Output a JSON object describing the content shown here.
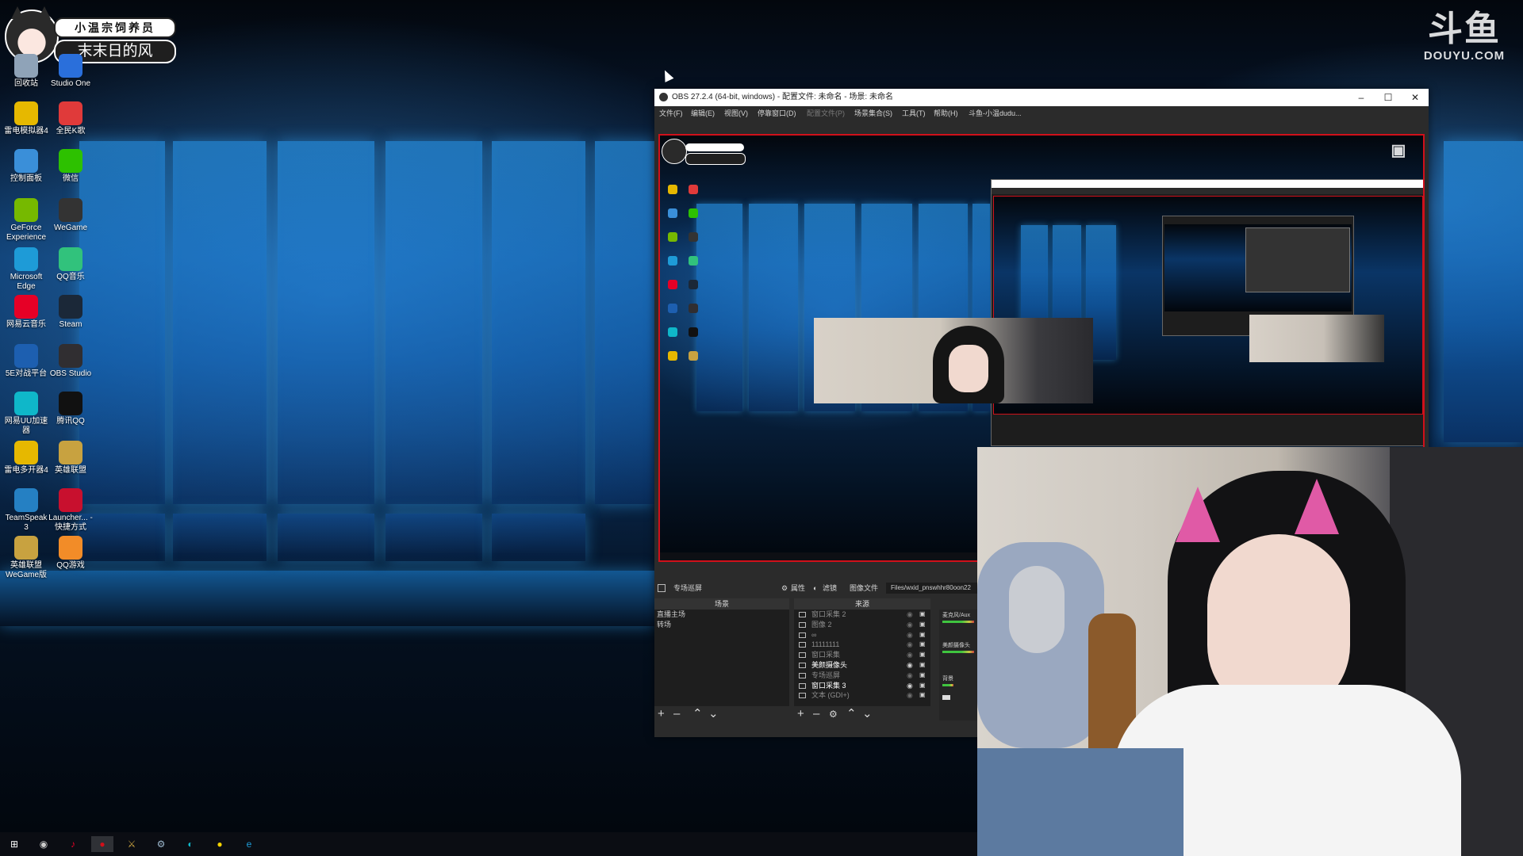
{
  "overlay": {
    "badge_top": "小温宗饲养员",
    "badge_bottom": "末末日的风",
    "brand_mark": "斗鱼",
    "brand_text": "DOUYU.COM"
  },
  "desktop": {
    "icons": [
      {
        "label": "回收站",
        "icon": "recycle-bin-icon",
        "color": "#8fa3b8"
      },
      {
        "label": "Studio One",
        "icon": "studio-one-icon",
        "color": "#2a6fdb"
      },
      {
        "label": "雷电模拟器4",
        "icon": "ldplayer-icon",
        "color": "#e6b800"
      },
      {
        "label": "全民K歌",
        "icon": "kge-icon",
        "color": "#e03a3a"
      },
      {
        "label": "控制面板",
        "icon": "control-panel-icon",
        "color": "#3a8fd9"
      },
      {
        "label": "微信",
        "icon": "wechat-icon",
        "color": "#2dc100"
      },
      {
        "label": "GeForce Experience",
        "icon": "geforce-icon",
        "color": "#76b900"
      },
      {
        "label": "WeGame",
        "icon": "wegame-icon",
        "color": "#333333"
      },
      {
        "label": "Microsoft Edge",
        "icon": "edge-icon",
        "color": "#1e9bd7"
      },
      {
        "label": "QQ音乐",
        "icon": "qqmusic-icon",
        "color": "#31c27c"
      },
      {
        "label": "网易云音乐",
        "icon": "netease-music-icon",
        "color": "#e60026"
      },
      {
        "label": "Steam",
        "icon": "steam-icon",
        "color": "#1b2838"
      },
      {
        "label": "5E对战平台",
        "icon": "5e-icon",
        "color": "#1d5fb0"
      },
      {
        "label": "OBS Studio",
        "icon": "obs-icon",
        "color": "#302e31"
      },
      {
        "label": "网易UU加速器",
        "icon": "uu-icon",
        "color": "#0fb7c9"
      },
      {
        "label": "腾讯QQ",
        "icon": "qq-icon",
        "color": "#111111"
      },
      {
        "label": "雷电多开器4",
        "icon": "ld-multi-icon",
        "color": "#e6b800"
      },
      {
        "label": "英雄联盟",
        "icon": "lol-icon",
        "color": "#c8a240"
      },
      {
        "label": "TeamSpeak 3",
        "icon": "teamspeak-icon",
        "color": "#2580c3"
      },
      {
        "label": "Launcher... - 快捷方式",
        "icon": "launcher-icon",
        "color": "#c8102e"
      },
      {
        "label": "英雄联盟WeGame版",
        "icon": "lol-wegame-icon",
        "color": "#c8a240"
      },
      {
        "label": "QQ游戏",
        "icon": "qqgame-icon",
        "color": "#f28c28"
      }
    ]
  },
  "obs": {
    "title": "OBS 27.2.4 (64-bit, windows) - 配置文件: 未命名 - 场景: 未命名",
    "menu": [
      "文件(F)",
      "编辑(E)",
      "视图(V)",
      "停靠窗口(D)",
      "配置文件(P)",
      "场景集合(S)",
      "工具(T)",
      "帮助(H)",
      "斗鱼-小温dudu..."
    ],
    "dock": {
      "source_name": "专场巡屏",
      "properties": "属性",
      "filters": "滤镜",
      "image_file": "图像文件",
      "path": "Files/wxid_pnswhhr80oon22"
    },
    "scenes": {
      "header": "场景",
      "items": [
        "直播主场",
        "转场"
      ]
    },
    "sources": {
      "header": "来源",
      "items": [
        {
          "name": "窗口采集 2",
          "visible": false,
          "icon": "window-capture-icon"
        },
        {
          "name": "图像 2",
          "visible": false,
          "icon": "image-source-icon"
        },
        {
          "name": "∞",
          "visible": false,
          "icon": "link-icon"
        },
        {
          "name": "11111111",
          "visible": false,
          "icon": "text-source-icon"
        },
        {
          "name": "窗口采集",
          "visible": false,
          "icon": "window-capture-icon"
        },
        {
          "name": "美颜摄像头",
          "visible": true,
          "icon": "camera-source-icon"
        },
        {
          "name": "专场巡屏",
          "visible": false,
          "icon": "image-source-icon"
        },
        {
          "name": "窗口采集 3",
          "visible": true,
          "icon": "window-capture-icon"
        },
        {
          "name": "文本 (GDI+)",
          "visible": false,
          "icon": "text-source-icon"
        }
      ]
    },
    "mixer": {
      "ch1": "麦克风/Aux",
      "ch2": "美颜摄像头",
      "ch3": "背景"
    }
  },
  "taskbar": {
    "icons": [
      {
        "icon": "windows-start-icon",
        "color": "#ffffff",
        "glyph": "⊞"
      },
      {
        "icon": "obs-taskbar-icon",
        "color": "#cccccc",
        "glyph": "◉"
      },
      {
        "icon": "netease-music-taskbar-icon",
        "color": "#e60026",
        "glyph": "♪"
      },
      {
        "icon": "obs-active-taskbar-icon",
        "color": "#d0101a",
        "glyph": "●"
      },
      {
        "icon": "lol-taskbar-icon",
        "color": "#c8a240",
        "glyph": "⚔"
      },
      {
        "icon": "steam-taskbar-icon",
        "color": "#9fbad0",
        "glyph": "⚙"
      },
      {
        "icon": "uu-taskbar-icon",
        "color": "#0fb7c9",
        "glyph": "◐"
      },
      {
        "icon": "qqmusic-taskbar-icon",
        "color": "#f5d300",
        "glyph": "●"
      },
      {
        "icon": "edge-taskbar-icon",
        "color": "#1e9bd7",
        "glyph": "e"
      }
    ]
  }
}
